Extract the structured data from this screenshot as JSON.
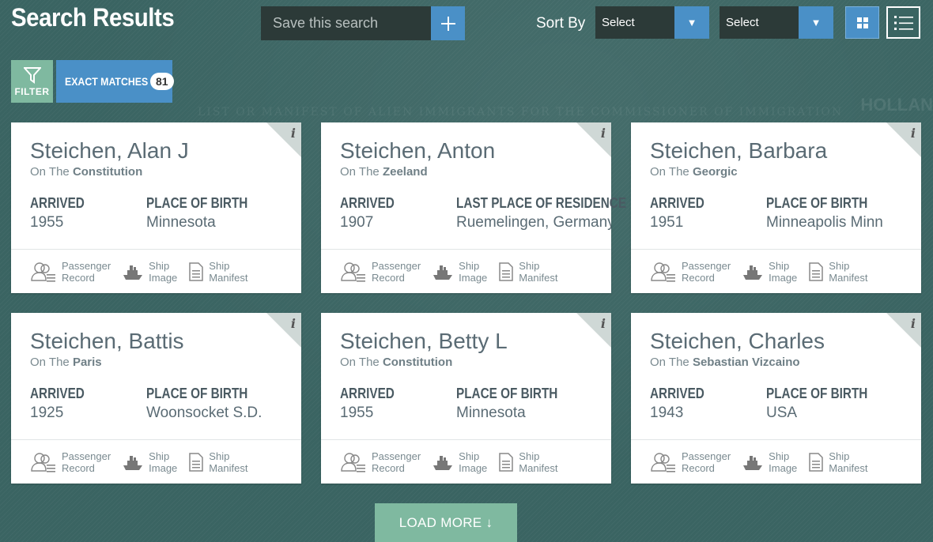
{
  "header": {
    "title": "Search Results",
    "save_placeholder": "Save this search",
    "sort_label": "Sort By",
    "sort_select_1": "Select",
    "sort_select_2": "Select"
  },
  "filter": {
    "filter_label": "FILTER",
    "exact_label": "EXACT MATCHES",
    "exact_count": "81"
  },
  "background": {
    "manifest_text": "LIST OR MANIFEST OF ALIEN IMMIGRANTS FOR THE COMMISSIONER OF IMMIGRATION",
    "holland_text": "HOLLAN"
  },
  "card_labels": {
    "on_the": "On The",
    "arrived": "ARRIVED",
    "passenger_record_1": "Passenger",
    "passenger_record_2": "Record",
    "ship_image_1": "Ship",
    "ship_image_2": "Image",
    "ship_manifest_1": "Ship",
    "ship_manifest_2": "Manifest",
    "info": "i"
  },
  "results": [
    {
      "name": "Steichen, Alan J",
      "ship": "Constitution",
      "arrived": "1955",
      "second_label": "PLACE OF BIRTH",
      "second_value": "Minnesota"
    },
    {
      "name": "Steichen, Anton",
      "ship": "Zeeland",
      "arrived": "1907",
      "second_label": "LAST PLACE OF RESIDENCE",
      "second_value": "Ruemelingen, Germany"
    },
    {
      "name": "Steichen, Barbara",
      "ship": "Georgic",
      "arrived": "1951",
      "second_label": "PLACE OF BIRTH",
      "second_value": "Minneapolis Minn"
    },
    {
      "name": "Steichen, Battis",
      "ship": "Paris",
      "arrived": "1925",
      "second_label": "PLACE OF BIRTH",
      "second_value": "Woonsocket S.D."
    },
    {
      "name": "Steichen, Betty L",
      "ship": "Constitution",
      "arrived": "1955",
      "second_label": "PLACE OF BIRTH",
      "second_value": "Minnesota"
    },
    {
      "name": "Steichen, Charles",
      "ship": "Sebastian Vizcaino",
      "arrived": "1943",
      "second_label": "PLACE OF BIRTH",
      "second_value": "USA"
    }
  ],
  "load_more": "LOAD MORE ↓",
  "colors": {
    "background": "#3a6462",
    "accent_blue": "#4a90c7",
    "accent_green": "#7fb9a0",
    "dark_input": "#2c3a38"
  }
}
